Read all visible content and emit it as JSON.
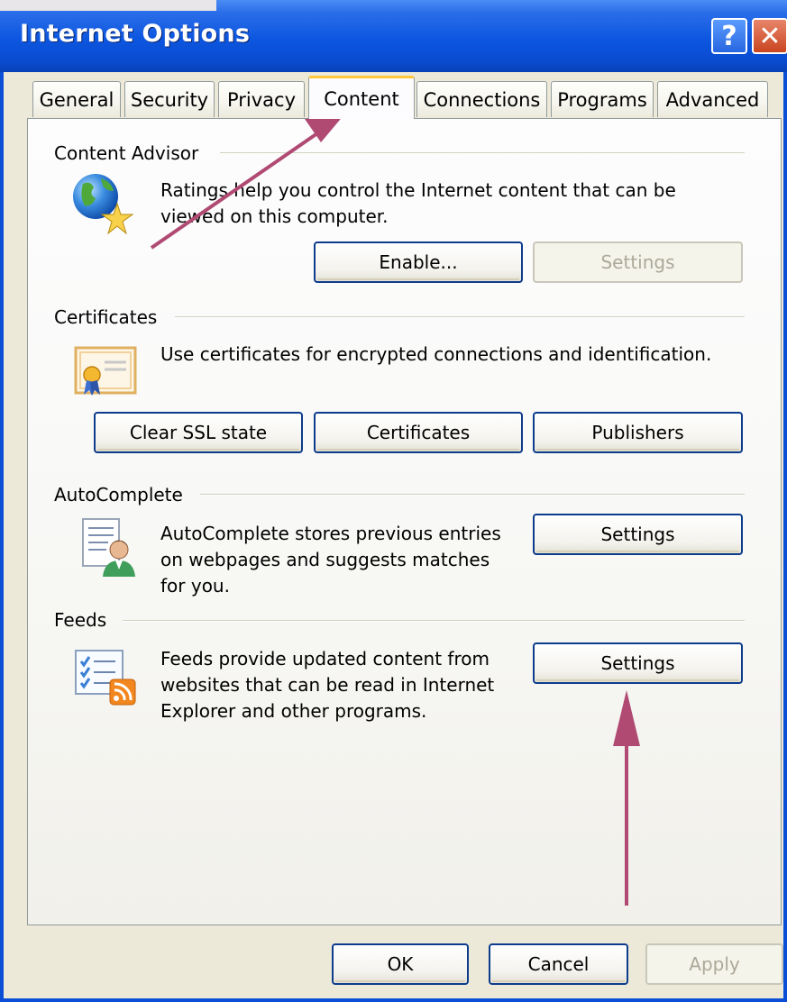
{
  "window": {
    "title": "Internet Options",
    "help_glyph": "?",
    "close_glyph": "✕"
  },
  "tabs": [
    {
      "label": "General",
      "active": false
    },
    {
      "label": "Security",
      "active": false
    },
    {
      "label": "Privacy",
      "active": false
    },
    {
      "label": "Content",
      "active": true
    },
    {
      "label": "Connections",
      "active": false
    },
    {
      "label": "Programs",
      "active": false
    },
    {
      "label": "Advanced",
      "active": false
    }
  ],
  "content_advisor": {
    "heading": "Content Advisor",
    "icon": "globe-star-icon",
    "description_line1": "Ratings help you control the Internet content that can be",
    "description_line2": "viewed on this computer.",
    "enable_label": "Enable...",
    "settings_label": "Settings"
  },
  "certificates": {
    "heading": "Certificates",
    "icon": "certificate-icon",
    "description": "Use certificates for encrypted connections and identification.",
    "clear_ssl_label": "Clear SSL state",
    "certificates_label": "Certificates",
    "publishers_label": "Publishers"
  },
  "autocomplete": {
    "heading": "AutoComplete",
    "icon": "autocomplete-user-icon",
    "description_line1": "AutoComplete stores previous entries",
    "description_line2": "on webpages and suggests matches",
    "description_line3": "for you.",
    "settings_label": "Settings"
  },
  "feeds": {
    "heading": "Feeds",
    "icon": "feeds-rss-icon",
    "description_line1": "Feeds provide updated content from",
    "description_line2": "websites that can be read in Internet",
    "description_line3": "Explorer and other programs.",
    "settings_label": "Settings"
  },
  "footer": {
    "ok_label": "OK",
    "cancel_label": "Cancel",
    "apply_label": "Apply"
  },
  "annotation": {
    "arrow_color": "#b04a73"
  }
}
